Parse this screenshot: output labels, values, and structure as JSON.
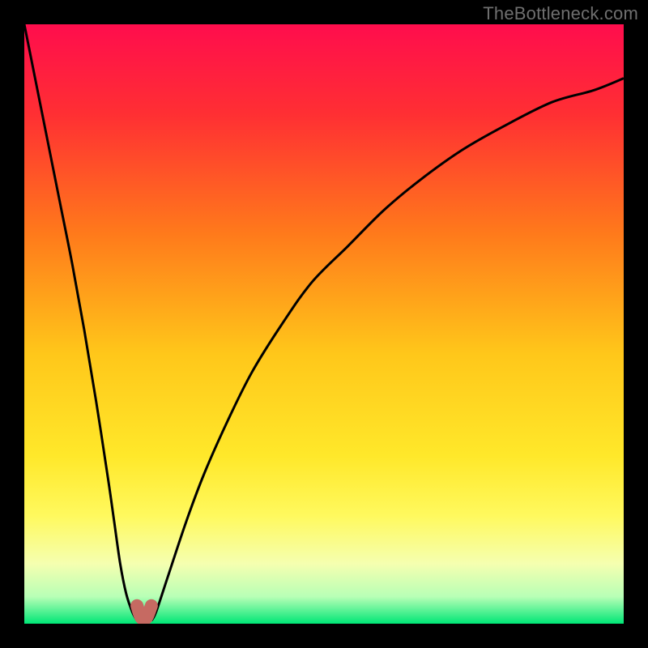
{
  "watermark": {
    "text": "TheBottleneck.com"
  },
  "chart_data": {
    "type": "line",
    "title": "",
    "xlabel": "",
    "ylabel": "",
    "xlim": [
      0,
      100
    ],
    "ylim": [
      0,
      100
    ],
    "grid": false,
    "legend": false,
    "background_gradient": {
      "direction": "vertical",
      "stops": [
        {
          "pos": 0.0,
          "color": "#ff0d4d"
        },
        {
          "pos": 0.15,
          "color": "#ff2f33"
        },
        {
          "pos": 0.35,
          "color": "#ff7a1b"
        },
        {
          "pos": 0.55,
          "color": "#ffc71a"
        },
        {
          "pos": 0.72,
          "color": "#ffe82a"
        },
        {
          "pos": 0.82,
          "color": "#fff95e"
        },
        {
          "pos": 0.9,
          "color": "#f5ffb0"
        },
        {
          "pos": 0.955,
          "color": "#b8ffb6"
        },
        {
          "pos": 1.0,
          "color": "#00e676"
        }
      ]
    },
    "series": [
      {
        "name": "curve-left",
        "stroke": "#000000",
        "stroke_width": 3,
        "x": [
          0,
          2,
          4,
          6,
          8,
          10,
          12,
          14,
          15,
          16,
          17,
          18,
          18.8
        ],
        "y": [
          100,
          90,
          80,
          70,
          60,
          49,
          37,
          24,
          17,
          10,
          5,
          2,
          0.5
        ]
      },
      {
        "name": "curve-right",
        "stroke": "#000000",
        "stroke_width": 3,
        "x": [
          21.2,
          22,
          24,
          27,
          30,
          34,
          38,
          43,
          48,
          54,
          60,
          66,
          73,
          80,
          88,
          95,
          100
        ],
        "y": [
          0.5,
          2,
          8,
          17,
          25,
          34,
          42,
          50,
          57,
          63,
          69,
          74,
          79,
          83,
          87,
          89,
          91
        ]
      },
      {
        "name": "trough-marker",
        "stroke": "#c66a62",
        "stroke_width": 16,
        "linecap": "round",
        "x": [
          18.8,
          19.5,
          20.4,
          21.2
        ],
        "y": [
          3.0,
          1.0,
          1.0,
          3.0
        ]
      }
    ],
    "annotations": []
  }
}
